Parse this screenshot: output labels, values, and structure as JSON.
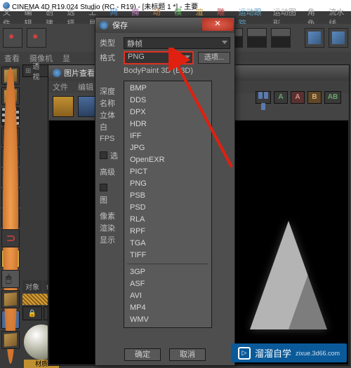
{
  "app": {
    "title": "CINEMA 4D R19.024 Studio (RC - R19) - [未标题 1 *] - 主要"
  },
  "menubar": [
    "文件",
    "编辑",
    "创建",
    "选择",
    "工具",
    "网格",
    "捕捉",
    "动画",
    "模拟",
    "渲染",
    "雕刻",
    "运动跟踪",
    "运动图形",
    "角色",
    "流水线"
  ],
  "secondbar": [
    "查看",
    "摄像机",
    "显"
  ],
  "perspTab": "透视",
  "viewer": {
    "title": "图片查看器",
    "menus": [
      "文件",
      "编辑"
    ]
  },
  "save": {
    "title": "保存",
    "rows": {
      "type_l": "类型",
      "type_v": "静帧",
      "format_l": "格式",
      "format_v": "PNG",
      "depth_l": "深度",
      "name_l": "名称",
      "name_v": "BodyPaint 3D (B3D)",
      "solid_l": "立体",
      "white_l": "白",
      "fps_l": "FPS",
      "chk1": "选",
      "highq_l": "高级",
      "imgcolor_l": "图",
      "pixratio_l": "像素",
      "render_l": "渲染",
      "display_l": "显示"
    },
    "opt_btn": "选项...",
    "ok": "确定",
    "cancel": "取消"
  },
  "formats": [
    "BMP",
    "DDS",
    "DPX",
    "HDR",
    "IFF",
    "JPG",
    "OpenEXR",
    "PICT",
    "PNG",
    "PSB",
    "PSD",
    "RLA",
    "RPF",
    "TGA",
    "TIFF",
    "",
    "3GP",
    "ASF",
    "AVI",
    "MP4",
    "WMV"
  ],
  "mini": {
    "tab1": "对象",
    "tab2": "创",
    "label": "材质"
  },
  "watermark": {
    "brand": "溜溜自学",
    "sub": "zixue.3d66.com"
  }
}
